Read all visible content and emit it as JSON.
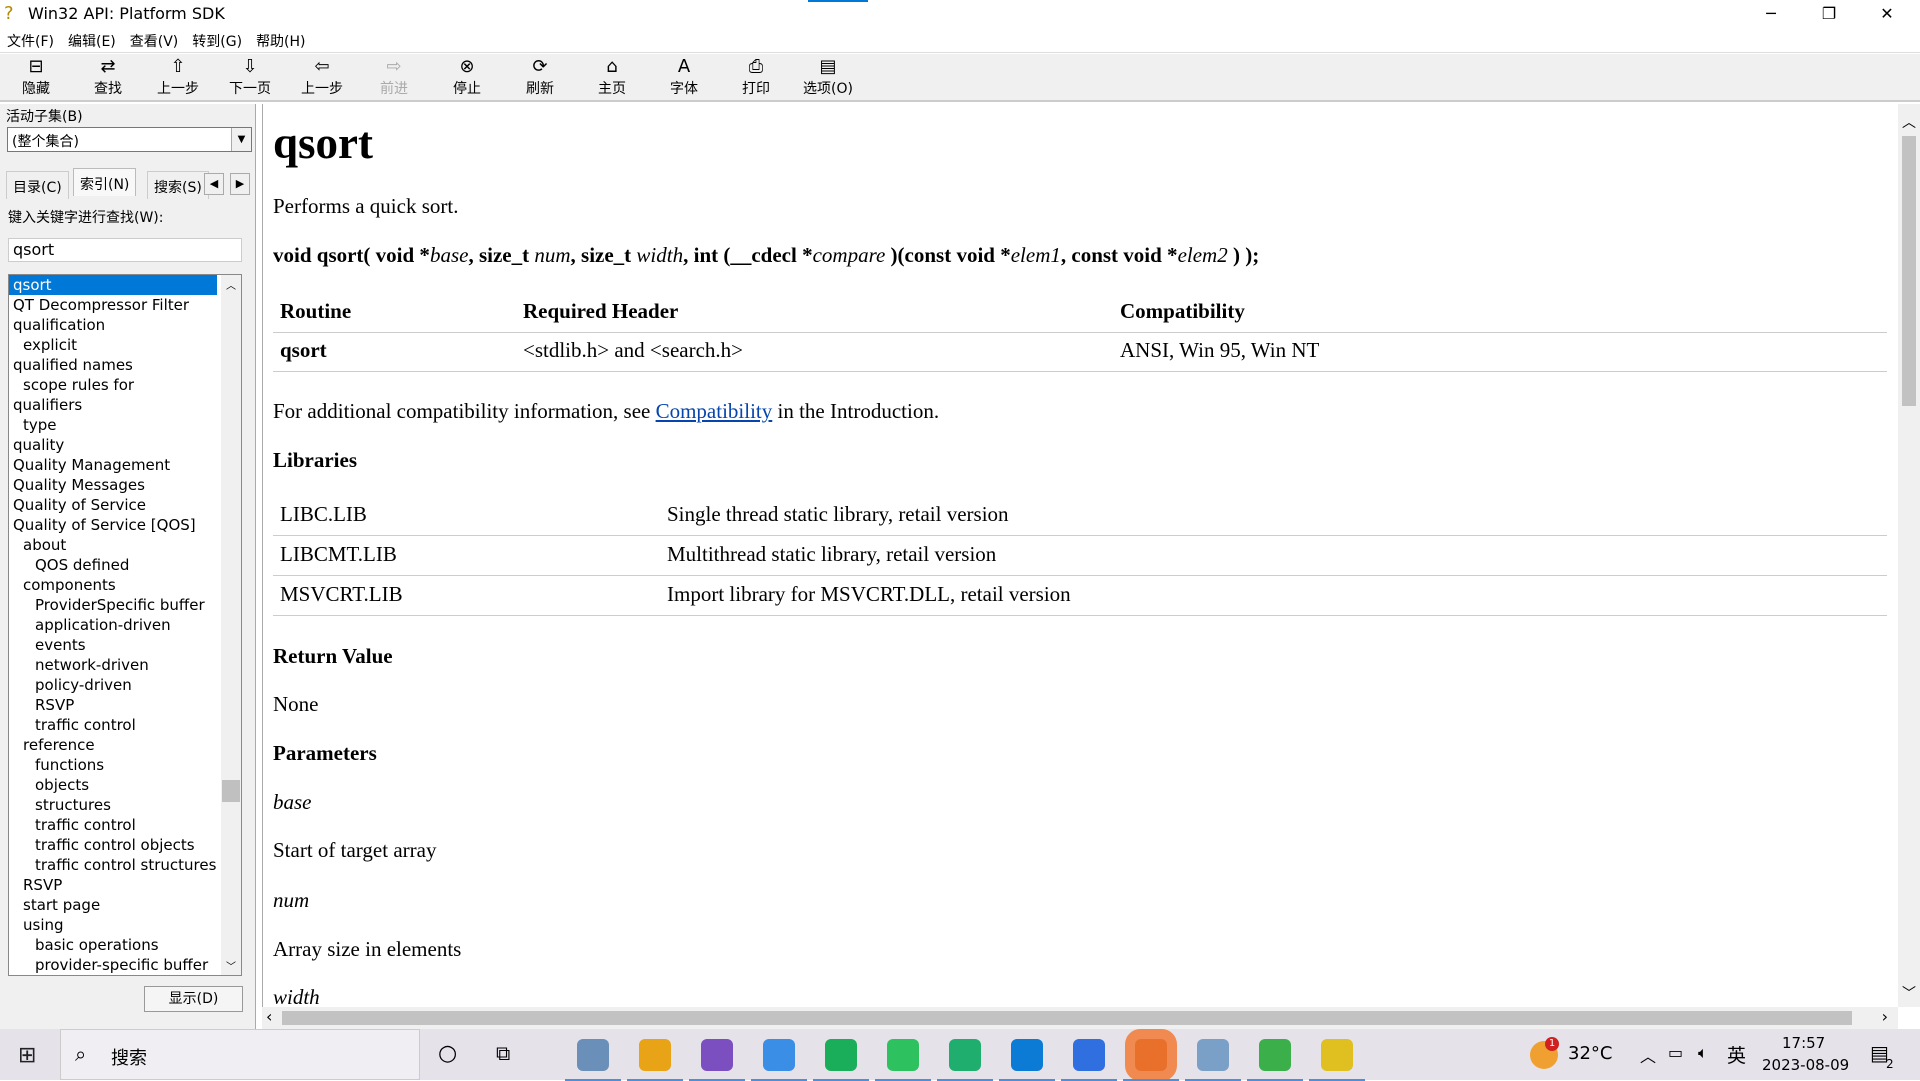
{
  "window": {
    "title": "Win32 API: Platform SDK"
  },
  "menu": [
    "文件(F)",
    "编辑(E)",
    "查看(V)",
    "转到(G)",
    "帮助(H)"
  ],
  "toolbar": [
    {
      "label": "隐藏",
      "icon": "hide-icon",
      "g": "⊟"
    },
    {
      "label": "查找",
      "icon": "locate-icon",
      "g": "⇄"
    },
    {
      "label": "上一步",
      "icon": "up-arrow-icon",
      "g": "⇧"
    },
    {
      "label": "下一页",
      "icon": "down-arrow-icon",
      "g": "⇩"
    },
    {
      "label": "上一步",
      "icon": "back-arrow-icon",
      "g": "⇦"
    },
    {
      "label": "前进",
      "icon": "forward-arrow-icon",
      "g": "⇨",
      "disabled": true
    },
    {
      "label": "停止",
      "icon": "stop-icon",
      "g": "⊗"
    },
    {
      "label": "刷新",
      "icon": "refresh-icon",
      "g": "⟳"
    },
    {
      "label": "主页",
      "icon": "home-icon",
      "g": "⌂"
    },
    {
      "label": "字体",
      "icon": "font-icon",
      "g": "A"
    },
    {
      "label": "打印",
      "icon": "print-icon",
      "g": "⎙"
    },
    {
      "label": "选项(O)",
      "icon": "options-icon",
      "g": "▤"
    }
  ],
  "left": {
    "subset_label": "活动子集(B)",
    "subset_value": "(整个集合)",
    "tabs": [
      "目录(C)",
      "索引(N)",
      "搜索(S)"
    ],
    "keyword_label": "键入关键字进行查找(W):",
    "keyword_value": "qsort",
    "show_button": "显示(D)",
    "items": [
      {
        "t": "qsort",
        "l": 0
      },
      {
        "t": "QT Decompressor Filter",
        "l": 0
      },
      {
        "t": "qualification",
        "l": 0
      },
      {
        "t": "explicit",
        "l": 1
      },
      {
        "t": "qualified names",
        "l": 0
      },
      {
        "t": "scope rules for",
        "l": 1
      },
      {
        "t": "qualifiers",
        "l": 0
      },
      {
        "t": "type",
        "l": 1
      },
      {
        "t": "quality",
        "l": 0
      },
      {
        "t": "Quality Management",
        "l": 0
      },
      {
        "t": "Quality Messages",
        "l": 0
      },
      {
        "t": "Quality of Service",
        "l": 0
      },
      {
        "t": "Quality of Service [QOS]",
        "l": 0
      },
      {
        "t": "about",
        "l": 1
      },
      {
        "t": "QOS defined",
        "l": 2
      },
      {
        "t": "components",
        "l": 1
      },
      {
        "t": "ProviderSpecific buffer",
        "l": 2
      },
      {
        "t": "application-driven",
        "l": 2
      },
      {
        "t": "events",
        "l": 2
      },
      {
        "t": "network-driven",
        "l": 2
      },
      {
        "t": "policy-driven",
        "l": 2
      },
      {
        "t": "RSVP",
        "l": 2
      },
      {
        "t": "traffic control",
        "l": 2
      },
      {
        "t": "reference",
        "l": 1
      },
      {
        "t": "functions",
        "l": 2
      },
      {
        "t": "objects",
        "l": 2
      },
      {
        "t": "structures",
        "l": 2
      },
      {
        "t": "traffic control",
        "l": 2
      },
      {
        "t": "traffic control objects",
        "l": 2
      },
      {
        "t": "traffic control structures",
        "l": 2
      },
      {
        "t": "RSVP",
        "l": 1
      },
      {
        "t": "start page",
        "l": 1
      },
      {
        "t": "using",
        "l": 1
      },
      {
        "t": "basic operations",
        "l": 2
      },
      {
        "t": "provider-specific buffer",
        "l": 2
      }
    ]
  },
  "doc": {
    "title": "qsort",
    "summary": "Performs a quick sort.",
    "sig": [
      "void qsort( void *",
      "base",
      ", size_t ",
      "num",
      ", size_t ",
      "width",
      ", int (__cdecl *",
      "compare",
      " )(const void *",
      "elem1",
      ", const void *",
      "elem2",
      " ) );"
    ],
    "table_headers": [
      "Routine",
      "Required Header",
      "Compatibility"
    ],
    "table_row": [
      "qsort",
      "<stdlib.h> and <search.h>",
      "ANSI, Win 95, Win NT"
    ],
    "compat_pre": "For additional compatibility information, see ",
    "compat_link": "Compatibility",
    "compat_post": " in the Introduction.",
    "libraries_h": "Libraries",
    "libs": [
      [
        "LIBC.LIB",
        "Single thread static library, retail version"
      ],
      [
        "LIBCMT.LIB",
        "Multithread static library, retail version"
      ],
      [
        "MSVCRT.LIB",
        "Import library for MSVCRT.DLL, retail version"
      ]
    ],
    "return_h": "Return Value",
    "return_v": "None",
    "params_h": "Parameters",
    "p1": "base",
    "p1d": "Start of target array",
    "p2": "num",
    "p2d": "Array size in elements",
    "p3": "width"
  },
  "taskbar": {
    "search": "搜索",
    "weather": "32°C",
    "weather_badge": "1",
    "ime": "英",
    "time": "17:57",
    "date": "2023-08-09",
    "notif": "2",
    "apps": [
      "#6a8fb8",
      "#e8a317",
      "#7b4fc0",
      "#3a8ee6",
      "#1aad5a",
      "#2dc160",
      "#1fae6e",
      "#0c7bd6",
      "#2f6fe0",
      "#e8702a",
      "#7aa0c8",
      "#3bb04a",
      "#e0c020"
    ]
  }
}
